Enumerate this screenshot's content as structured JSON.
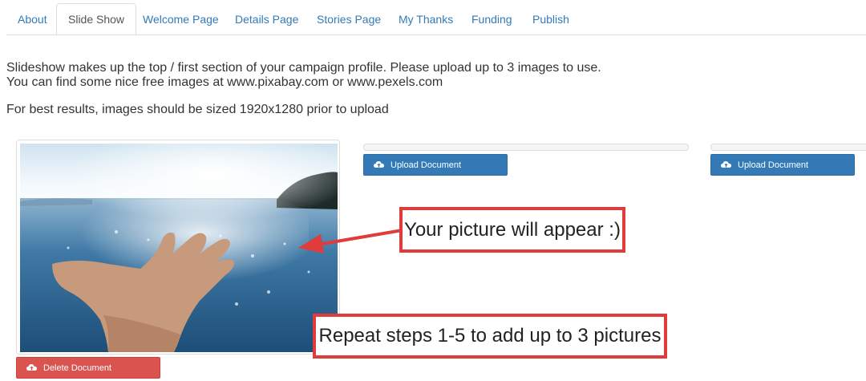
{
  "tabs": [
    {
      "label": "About"
    },
    {
      "label": "Slide Show"
    },
    {
      "label": "Welcome Page"
    },
    {
      "label": "Details Page"
    },
    {
      "label": "Stories Page"
    },
    {
      "label": "My Thanks"
    },
    {
      "label": "Funding"
    },
    {
      "label": "Publish"
    }
  ],
  "active_tab": "Slide Show",
  "intro": {
    "line1": "Slideshow makes up the top / first section of your campaign profile. Please upload up to 3 images to use.",
    "line2": "You can find some nice free images at www.pixabay.com or www.pexels.com",
    "line3": "For best results, images should be sized 1920x1280 prior to upload"
  },
  "slots": {
    "upload_label": "Upload Document",
    "delete_label": "Delete Document"
  },
  "annotations": {
    "picture_note": "Your picture will appear :)",
    "repeat_note": "Repeat steps 1-5 to add up to 3 pictures"
  },
  "colors": {
    "link": "#337ab7",
    "primary_button": "#337ab7",
    "danger_button": "#d9534f",
    "callout_border": "#e03c3c"
  },
  "icons": {
    "upload": "cloud-upload-icon"
  }
}
